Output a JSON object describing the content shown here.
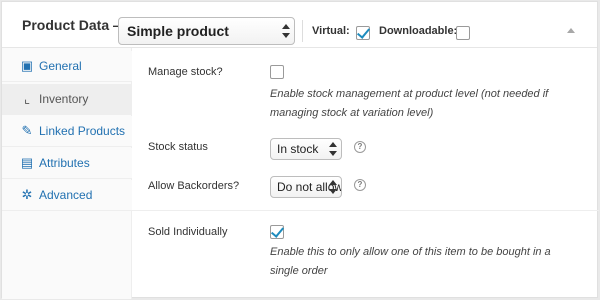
{
  "header": {
    "title": "Product Data —",
    "product_type": "Simple product",
    "virtual_label": "Virtual:",
    "virtual_checked": true,
    "downloadable_label": "Downloadable:",
    "downloadable_checked": false
  },
  "tabs": [
    {
      "label": "General",
      "icon": "gear-icon",
      "active": false
    },
    {
      "label": "Inventory",
      "icon": "chart-icon",
      "active": true
    },
    {
      "label": "Linked Products",
      "icon": "link-icon",
      "active": false
    },
    {
      "label": "Attributes",
      "icon": "list-icon",
      "active": false
    },
    {
      "label": "Advanced",
      "icon": "cog-icon",
      "active": false
    }
  ],
  "inventory": {
    "manage_stock_label": "Manage stock?",
    "manage_stock_checked": false,
    "manage_stock_desc": "Enable stock management at product level (not needed if managing stock at variation level)",
    "stock_status_label": "Stock status",
    "stock_status_value": "In stock",
    "backorders_label": "Allow Backorders?",
    "backorders_value": "Do not allow",
    "sold_individually_label": "Sold Individually",
    "sold_individually_checked": true,
    "sold_individually_desc": "Enable this to only allow one of this item to be bought in a single order"
  },
  "colors": {
    "accent": "#2271b1",
    "check": "#1e8cbe"
  }
}
